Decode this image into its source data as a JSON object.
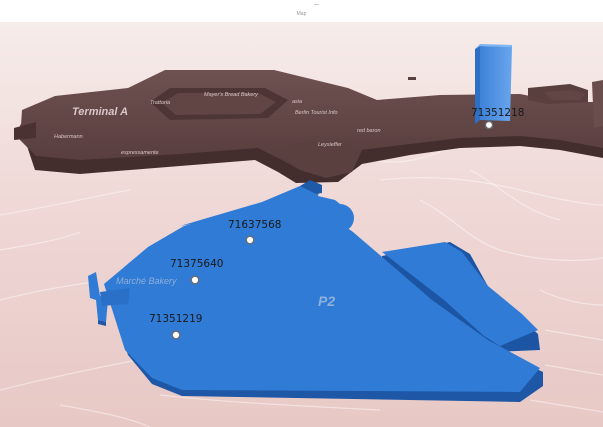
{
  "app": {
    "title": "Map"
  },
  "colors": {
    "terminal_fill": "#5d4343",
    "terminal_side": "#463030",
    "parking_fill": "#2f79d3",
    "parking_side": "#1f5aa8",
    "tower": "#4a8fe0",
    "bg_top": "#f6ebe9",
    "bg_bottom": "#e6c6c4"
  },
  "terminal": {
    "name": "Terminal A",
    "labels": {
      "trattoria": "Trattoria",
      "bakery_dark": "Mayer's Bread Bakery",
      "asia": "asia",
      "tourist": "Berlin Tourist Info",
      "habermann": "Habermann",
      "espressamente": "espressamente",
      "redbaron": "red baron",
      "leysieffer": "Leysieffer"
    }
  },
  "parking": {
    "name": "P2",
    "shop_label": "Marché Bakery"
  },
  "markers": [
    {
      "id": "71351218",
      "label": "71351218"
    },
    {
      "id": "71637568",
      "label": "71637568"
    },
    {
      "id": "71375640",
      "label": "71375640"
    },
    {
      "id": "71351219",
      "label": "71351219"
    }
  ]
}
